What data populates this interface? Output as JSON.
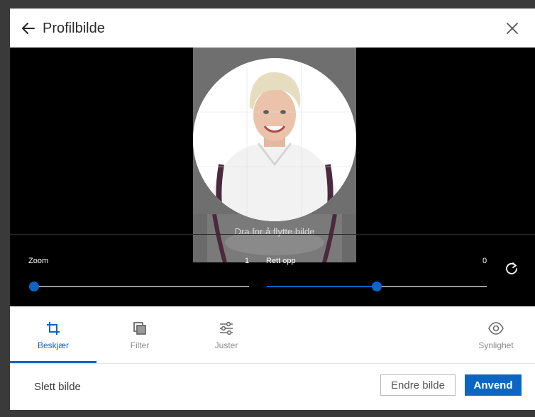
{
  "header": {
    "title": "Profilbilde",
    "back_icon": "arrow-left-icon",
    "close_icon": "close-icon"
  },
  "editor": {
    "drag_hint": "Dra for å flytte bilde",
    "zoom": {
      "label": "Zoom",
      "value": "1",
      "position_fraction": 0.0
    },
    "straighten": {
      "label": "Rett opp",
      "value": "0",
      "position_fraction": 0.5
    },
    "rotate_icon": "rotate-icon"
  },
  "tabs": [
    {
      "label": "Beskjær",
      "icon": "crop-icon",
      "active": true
    },
    {
      "label": "Filter",
      "icon": "filter-icon",
      "active": false
    },
    {
      "label": "Juster",
      "icon": "adjust-icon",
      "active": false
    },
    {
      "label": "Synlighet",
      "icon": "eye-icon",
      "active": false
    }
  ],
  "footer": {
    "delete_label": "Slett bilde",
    "change_label": "Endre bilde",
    "apply_label": "Anvend"
  },
  "colors": {
    "accent": "#0a66c2",
    "editor_bg": "#000000"
  }
}
